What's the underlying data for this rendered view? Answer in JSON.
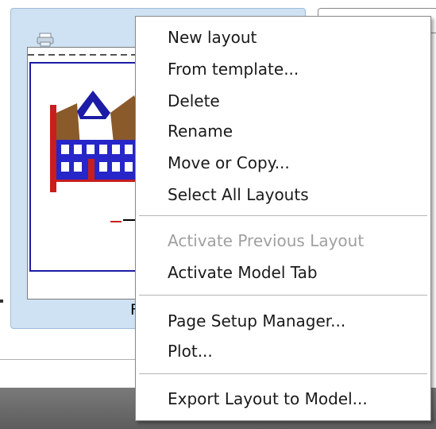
{
  "layout_card": {
    "label": "F"
  },
  "menu": {
    "items": [
      {
        "label": "New layout",
        "enabled": true
      },
      {
        "label": "From template...",
        "enabled": true
      },
      {
        "label": "Delete",
        "enabled": true
      },
      {
        "label": "Rename",
        "enabled": true
      },
      {
        "label": "Move or Copy...",
        "enabled": true
      },
      {
        "label": "Select All Layouts",
        "enabled": true
      },
      {
        "label": "Activate Previous Layout",
        "enabled": false
      },
      {
        "label": "Activate Model Tab",
        "enabled": true
      },
      {
        "label": "Page Setup Manager...",
        "enabled": true
      },
      {
        "label": "Plot...",
        "enabled": true
      },
      {
        "label": "Export Layout to Model...",
        "enabled": true
      }
    ]
  },
  "colors": {
    "drawing_blue": "#1c1ca6",
    "roof_brown": "#8b5a2b",
    "panel_bg": "#cfe2f3",
    "disabled_text": "#a0a0a0"
  }
}
